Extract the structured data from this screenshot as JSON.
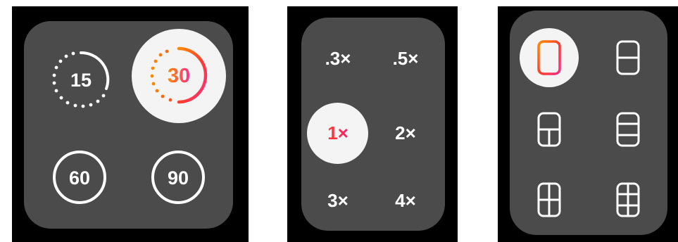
{
  "colors": {
    "panel": "#4b4b4b",
    "selected_bg": "#f4f4f4",
    "accent_start": "#ff8a00",
    "accent_mid": "#ff3b30",
    "accent_end": "#ff2d87",
    "icon": "#ffffff"
  },
  "timer_menu": {
    "options": [
      {
        "label": "15",
        "icon": "dotted-ring-timer-icon",
        "selected": false
      },
      {
        "label": "30",
        "icon": "dotted-ring-timer-icon",
        "selected": true
      },
      {
        "label": "60",
        "icon": "ring-timer-icon",
        "selected": false
      },
      {
        "label": "90",
        "icon": "ring-timer-icon",
        "selected": false
      }
    ]
  },
  "zoom_menu": {
    "options": [
      {
        "label": ".3×",
        "selected": false
      },
      {
        "label": ".5×",
        "selected": false
      },
      {
        "label": "1×",
        "selected": true
      },
      {
        "label": "2×",
        "selected": false
      },
      {
        "label": "3×",
        "selected": false
      },
      {
        "label": "4×",
        "selected": false
      }
    ]
  },
  "layout_menu": {
    "options": [
      {
        "icon": "layout-two-columns-icon",
        "selected": true
      },
      {
        "icon": "layout-two-rows-icon",
        "selected": false
      },
      {
        "icon": "layout-top-bottom-split-icon",
        "selected": false
      },
      {
        "icon": "layout-three-rows-icon",
        "selected": false
      },
      {
        "icon": "layout-grid-four-icon",
        "selected": false
      },
      {
        "icon": "layout-grid-six-icon",
        "selected": false
      }
    ]
  }
}
